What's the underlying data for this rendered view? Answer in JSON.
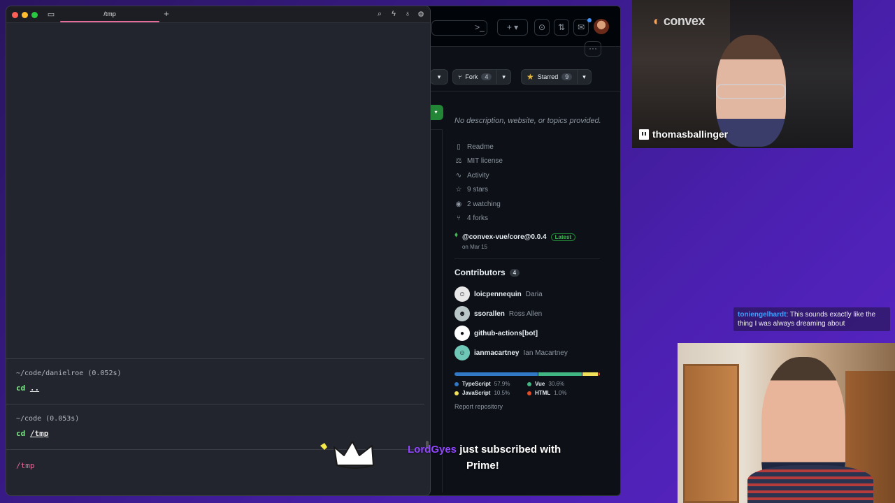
{
  "terminal": {
    "tab_title": "/tmp",
    "blocks": [
      {
        "path": "~/code/danielroe (0.052s)",
        "cmd": "cd",
        "arg": ".."
      },
      {
        "path": "~/code (0.053s)",
        "cmd": "cd",
        "arg": "/tmp"
      }
    ],
    "current_path": "/tmp",
    "icons": {
      "left": "book-icon",
      "add": "plus-icon",
      "right": [
        "search-icon",
        "lightning-icon",
        "bulb-icon",
        "gear-icon"
      ]
    }
  },
  "github": {
    "topbar_icons": [
      "terminal-icon",
      "plus-icon",
      "issues-icon",
      "pull-requests-icon",
      "inbox-icon"
    ],
    "fork_label": "Fork",
    "fork_count": "4",
    "starred_label": "Starred",
    "star_count": "9",
    "description": "No description, website, or topics provided.",
    "meta": [
      {
        "icon": "book-icon",
        "label": "Readme"
      },
      {
        "icon": "scale-icon",
        "label": "MIT license"
      },
      {
        "icon": "pulse-icon",
        "label": "Activity"
      },
      {
        "icon": "star-icon",
        "label": "9 stars"
      },
      {
        "icon": "eye-icon",
        "label": "2 watching"
      },
      {
        "icon": "fork-icon",
        "label": "4 forks"
      }
    ],
    "release": {
      "name": "@convex-vue/core@0.0.4",
      "badge": "Latest",
      "date": "on Mar 15"
    },
    "contributors_title": "Contributors",
    "contributors_count": "4",
    "contributors": [
      {
        "login": "loicpennequin",
        "name": "Daria"
      },
      {
        "login": "ssorallen",
        "name": "Ross Allen"
      },
      {
        "login": "github-actions[bot]",
        "name": ""
      },
      {
        "login": "ianmacartney",
        "name": "Ian Macartney"
      }
    ],
    "languages": [
      {
        "name": "TypeScript",
        "pct": "57.9%",
        "color": "#3178c6",
        "value": 57.9
      },
      {
        "name": "Vue",
        "pct": "30.6%",
        "color": "#41b883",
        "value": 30.6
      },
      {
        "name": "JavaScript",
        "pct": "10.5%",
        "color": "#f1e05a",
        "value": 10.5
      },
      {
        "name": "HTML",
        "pct": "1.0%",
        "color": "#e34c26",
        "value": 1.0
      }
    ],
    "report": "Report repository"
  },
  "stream": {
    "streamer_tag": "thomasballinger",
    "backdrop_logo": "convex",
    "alert": {
      "user": "LordGyes",
      "line1": " just subscribed with",
      "line2": "Prime!"
    },
    "chat": {
      "user": "toniengelhardt",
      "message": ": This sounds exactly like the thing I was always dreaming about"
    }
  }
}
